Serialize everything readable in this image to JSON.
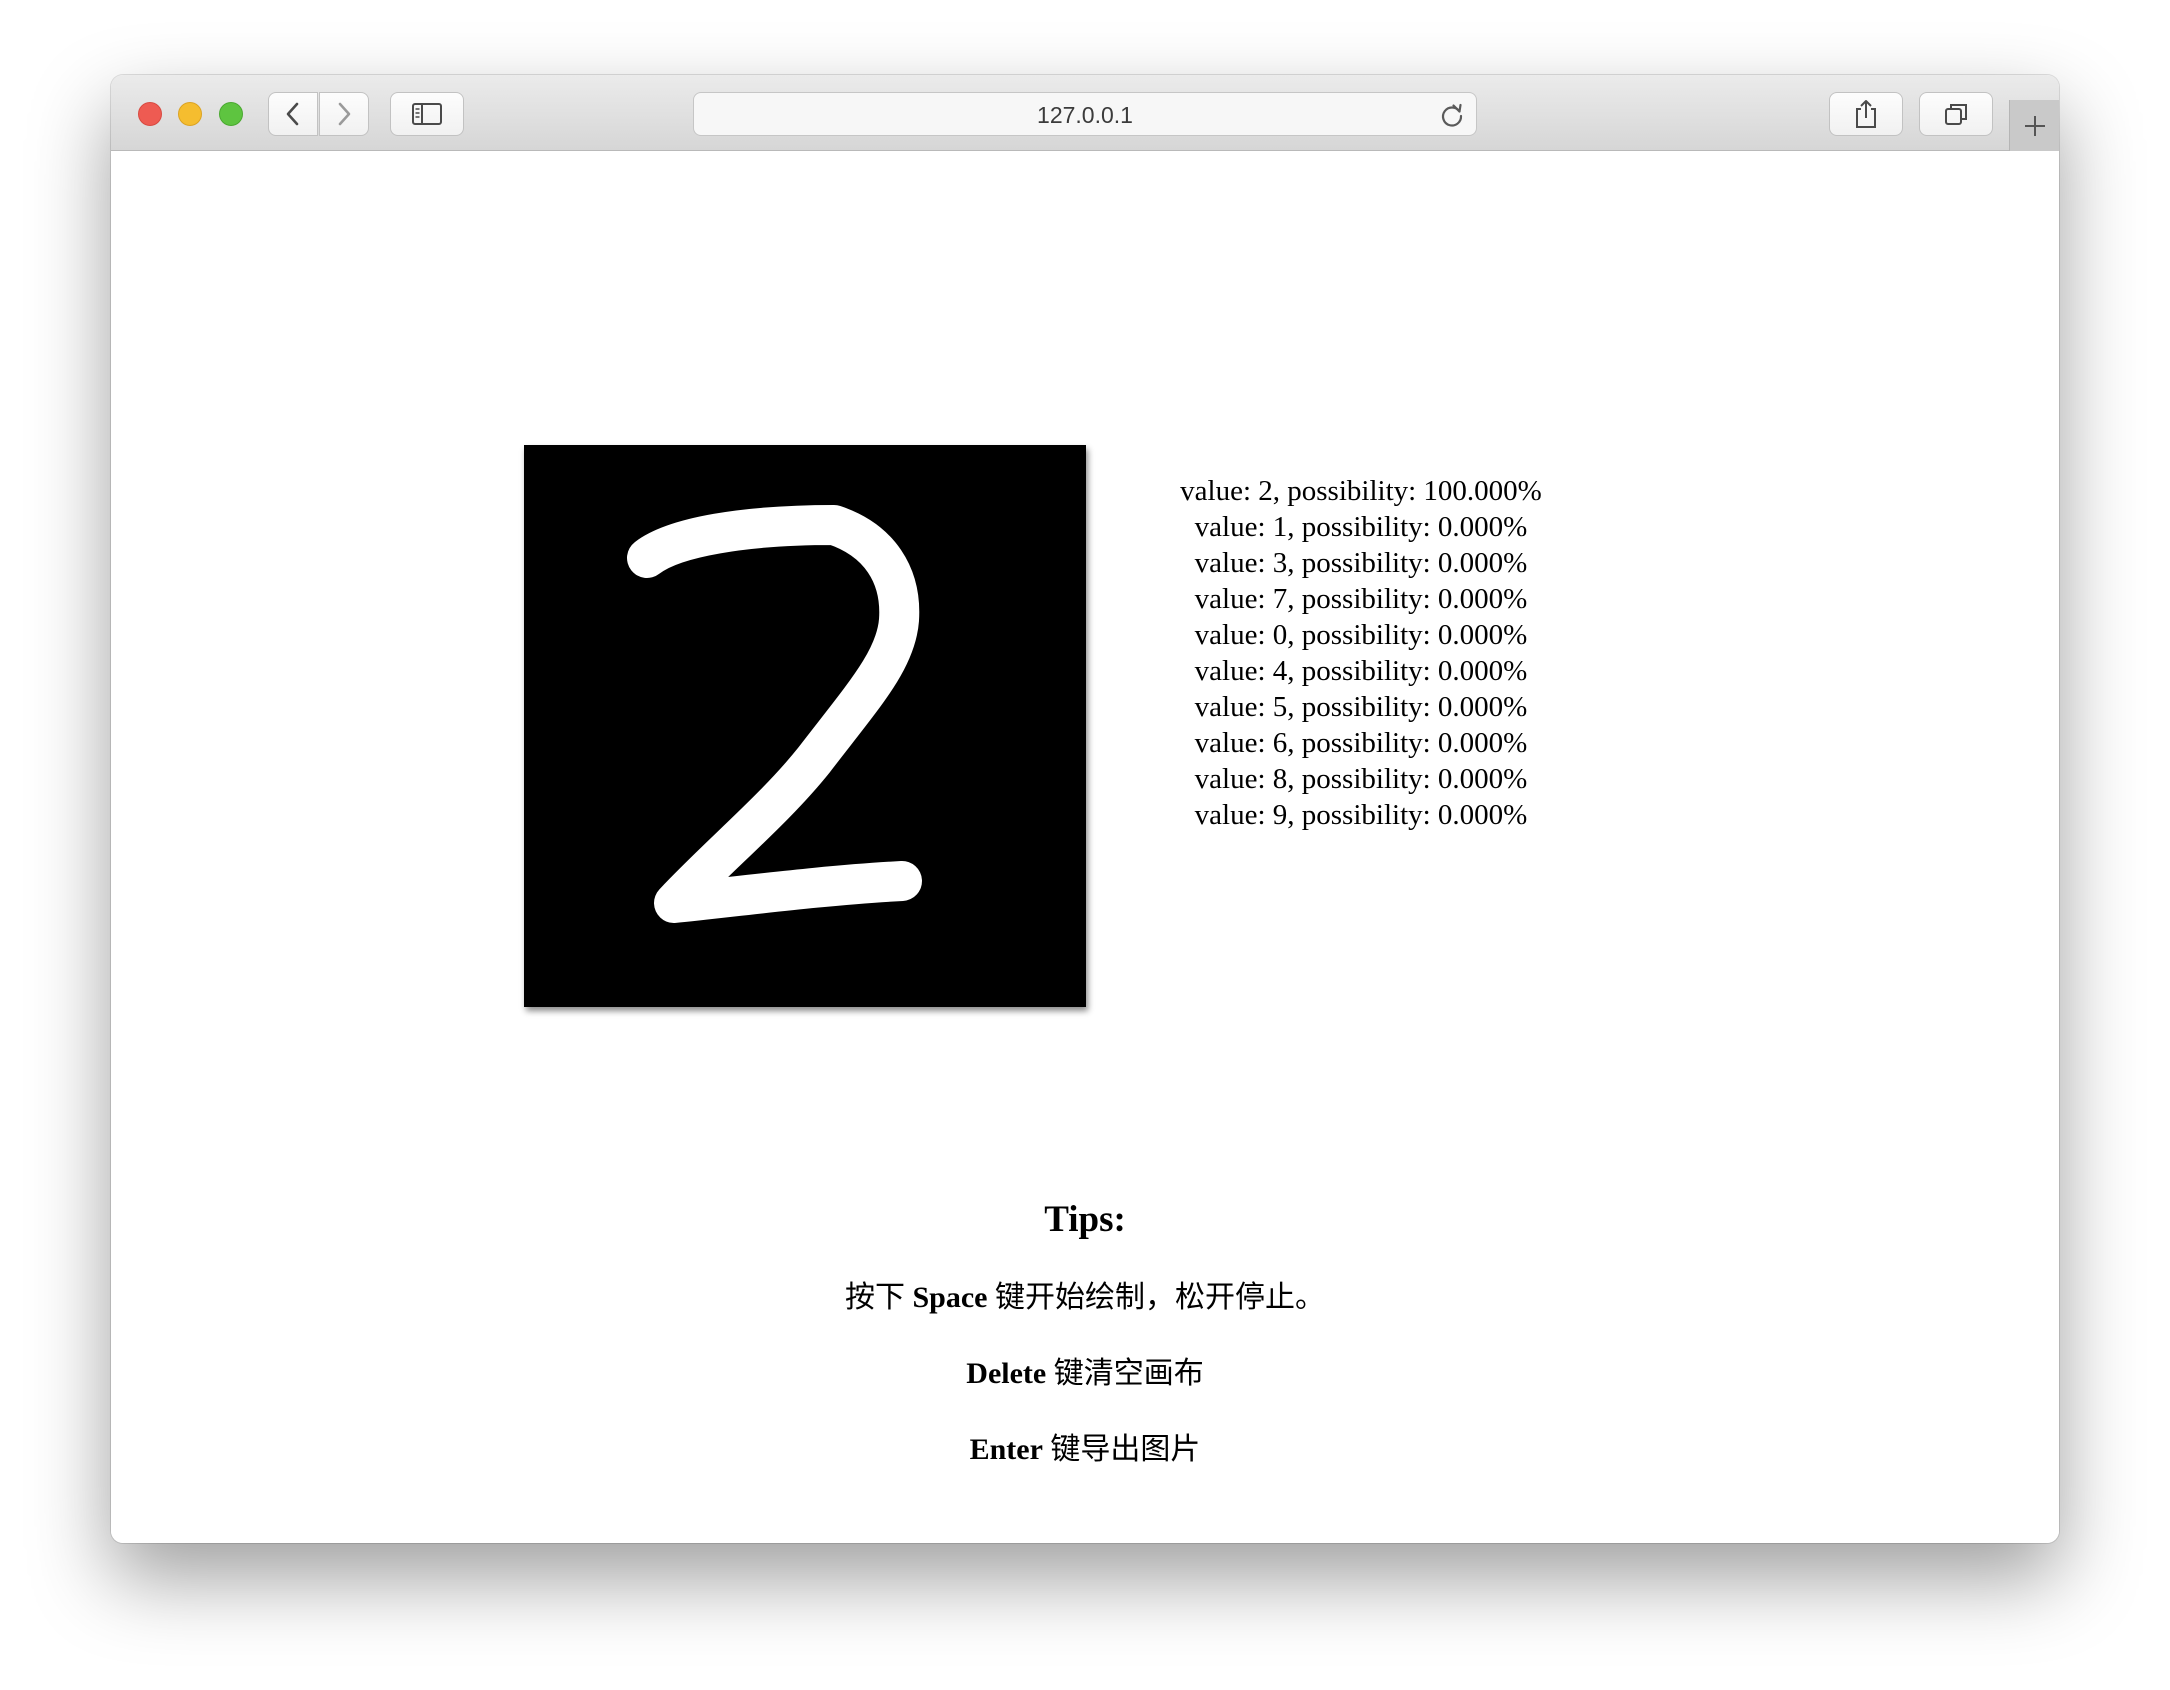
{
  "browser": {
    "url": "127.0.0.1",
    "icons": {
      "back": "chevron-left-icon",
      "forward": "chevron-right-icon",
      "sidebar": "sidebar-icon",
      "reload": "reload-icon",
      "share": "share-icon",
      "tabs": "tabs-overview-icon",
      "new_tab": "plus-icon"
    },
    "traffic_colors": {
      "close": "#ee5b52",
      "minimize": "#f5bd2f",
      "maximize": "#5ec440"
    }
  },
  "canvas": {
    "background": "#000000",
    "stroke_color": "#ffffff",
    "drawn_digit": "2"
  },
  "predictions": [
    {
      "text": "value: 2, possibility: 100.000%"
    },
    {
      "text": "value: 1, possibility: 0.000%"
    },
    {
      "text": "value: 3, possibility: 0.000%"
    },
    {
      "text": "value: 7, possibility: 0.000%"
    },
    {
      "text": "value: 0, possibility: 0.000%"
    },
    {
      "text": "value: 4, possibility: 0.000%"
    },
    {
      "text": "value: 5, possibility: 0.000%"
    },
    {
      "text": "value: 6, possibility: 0.000%"
    },
    {
      "text": "value: 8, possibility: 0.000%"
    },
    {
      "text": "value: 9, possibility: 0.000%"
    }
  ],
  "tips": {
    "title": "Tips:",
    "line1_prefix": "按下 ",
    "line1_key": "Space",
    "line1_suffix": " 键开始绘制，松开停止。",
    "line2_key": "Delete",
    "line2_suffix": " 键清空画布",
    "line3_key": "Enter",
    "line3_suffix": " 键导出图片"
  }
}
